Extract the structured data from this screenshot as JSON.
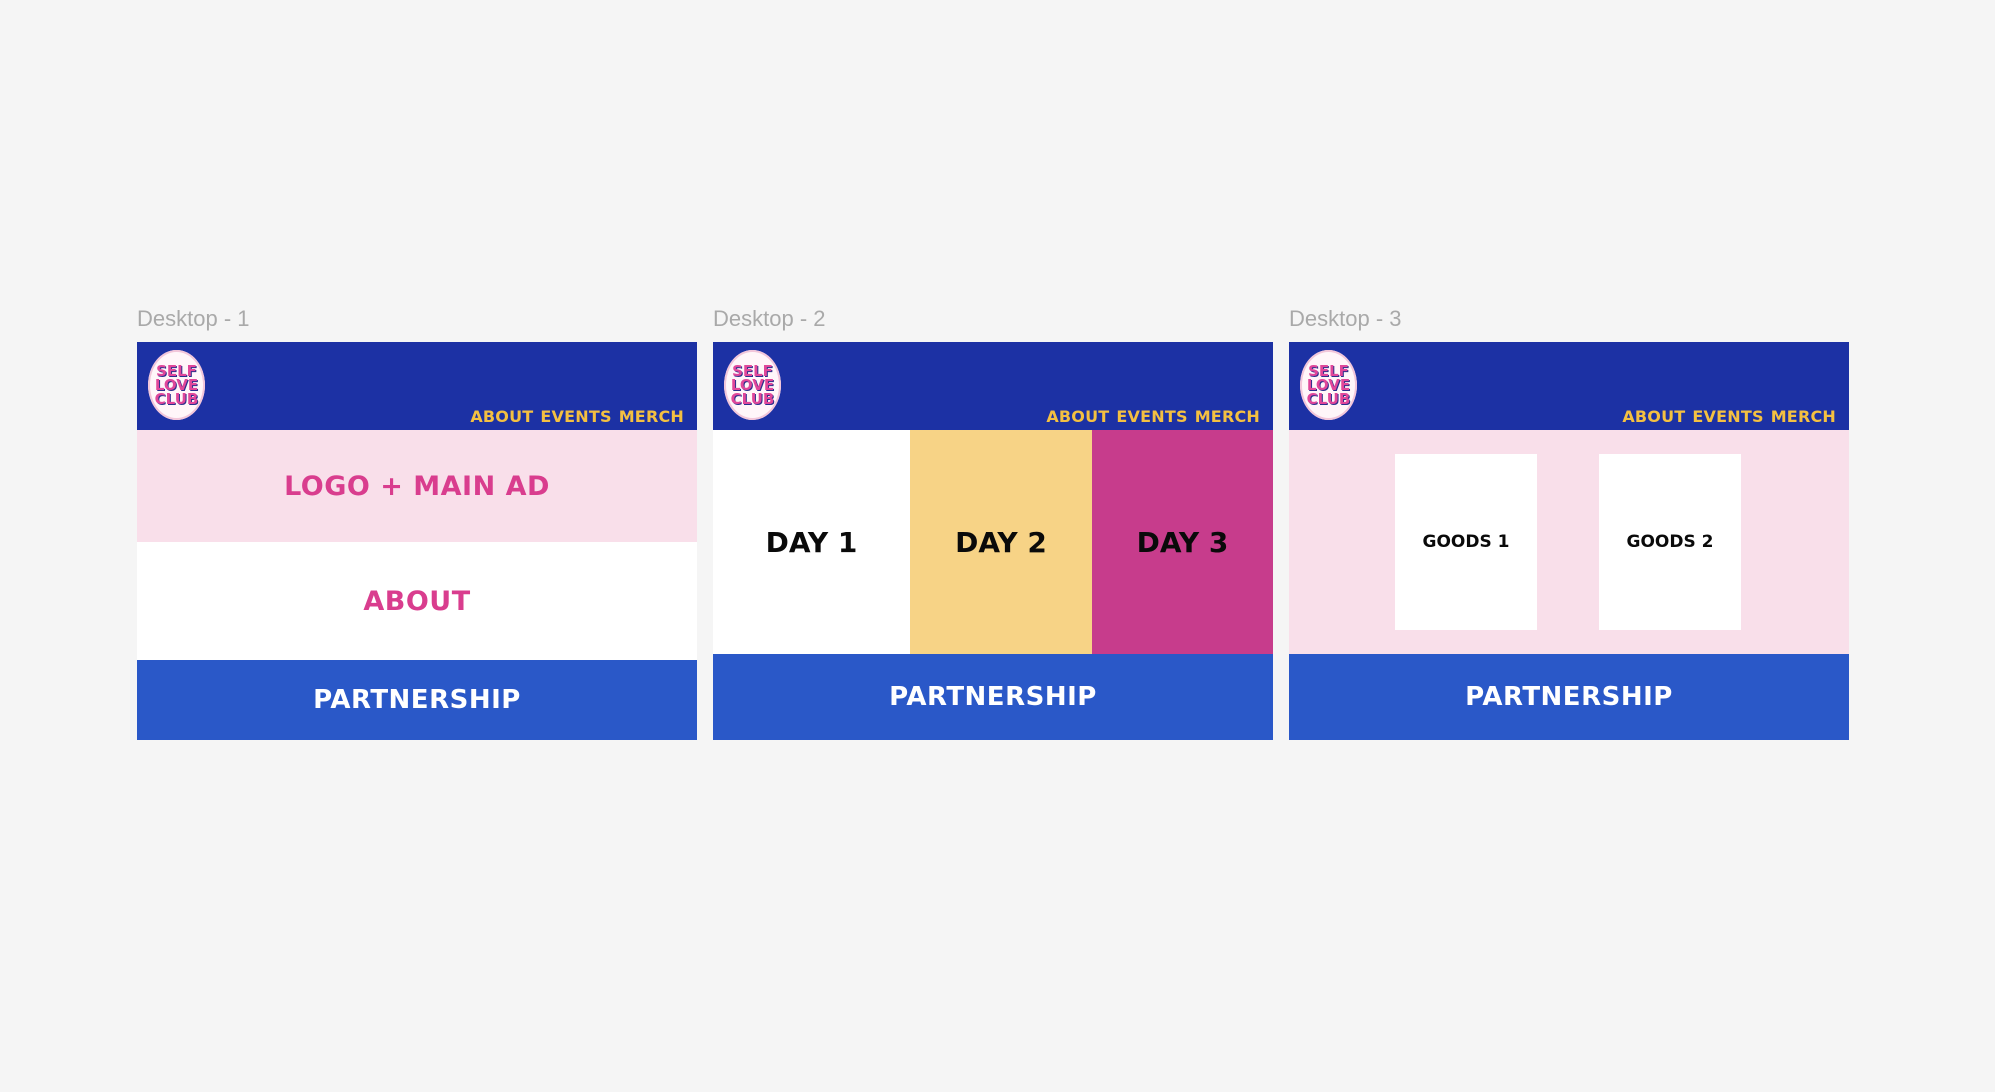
{
  "frames": [
    {
      "label": "Desktop - 1"
    },
    {
      "label": "Desktop - 2"
    },
    {
      "label": "Desktop - 3"
    }
  ],
  "logo": {
    "lines": [
      "SELF",
      "LOVE",
      "CLUB"
    ]
  },
  "nav": [
    "ABOUT",
    "EVENTS",
    "MERCH"
  ],
  "footer_label": "PARTNERSHIP",
  "desktop1": {
    "hero_label": "LOGO + MAIN AD",
    "about_label": "ABOUT"
  },
  "desktop2": {
    "days": [
      "DAY 1",
      "DAY 2",
      "DAY 3"
    ]
  },
  "desktop3": {
    "goods": [
      "GOODS 1",
      "GOODS 2"
    ]
  },
  "colors": {
    "header": "#1c31a4",
    "nav_text": "#f4c041",
    "footer": "#2a58c8",
    "pink_band": "#f9dfea",
    "pink_text": "#d93d8e",
    "day2": "#f7d386",
    "day3": "#c73c8c"
  }
}
